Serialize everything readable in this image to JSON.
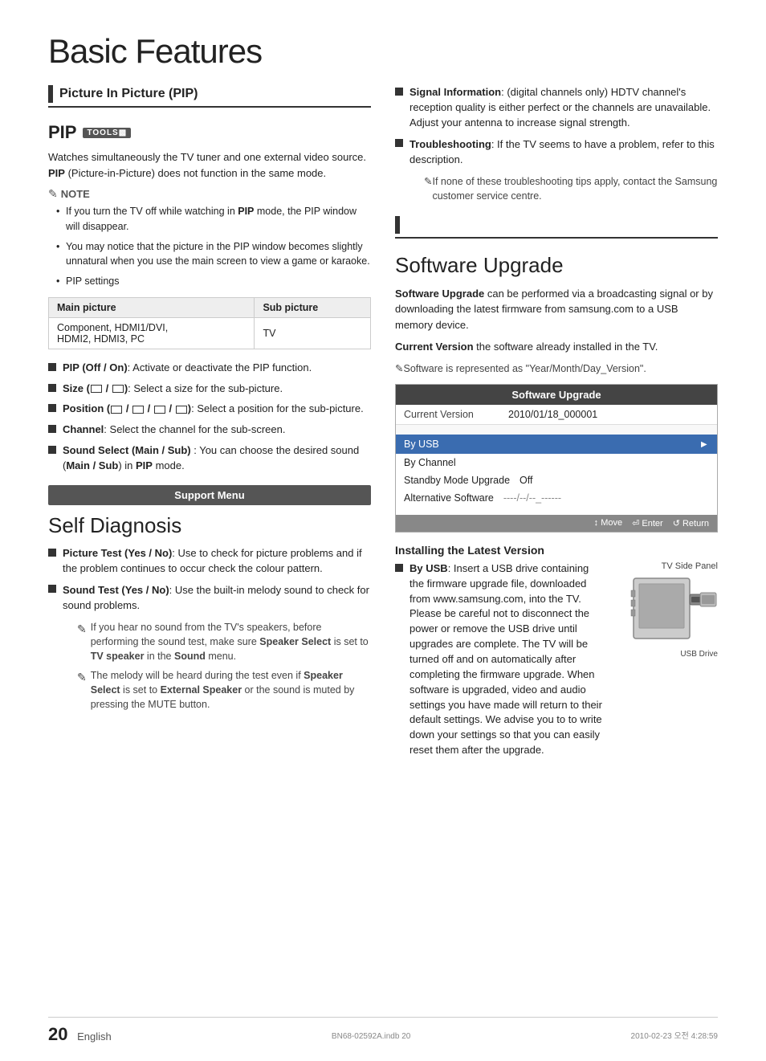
{
  "page": {
    "title": "Basic Features",
    "footer": {
      "page_number": "20",
      "language": "English",
      "file": "BN68-02592A.indb   20",
      "date": "2010-02-23   오전 4:28:59"
    }
  },
  "left_column": {
    "section_title": "Picture In Picture (PIP)",
    "pip": {
      "heading": "PIP",
      "tools_label": "TOOLS",
      "description": "Watches simultaneously the TV tuner and one external video source. PIP (Picture-in-Picture) does not function in the same mode.",
      "note_label": "NOTE",
      "notes": [
        "If you turn the TV off while watching in PIP mode, the PIP window will disappear.",
        "You may notice that the picture in the PIP window becomes slightly unnatural when you use the main screen to view a game or karaoke.",
        "PIP settings"
      ],
      "table": {
        "headers": [
          "Main picture",
          "Sub picture"
        ],
        "rows": [
          [
            "Component, HDMI1/DVI, HDMI2, HDMI3, PC",
            "TV"
          ]
        ]
      },
      "bullet_items": [
        {
          "label": "PIP (Off / On)",
          "text": ": Activate or deactivate the PIP function."
        },
        {
          "label": "Size (□ / □)",
          "text": ": Select a size for the sub-picture."
        },
        {
          "label": "Position (□ / □ / □ / □)",
          "text": ": Select a position for the sub-picture."
        },
        {
          "label": "Channel",
          "text": ": Select the channel for the sub-screen."
        },
        {
          "label": "Sound Select (Main / Sub)",
          "text": " : You can choose the desired sound (Main / Sub) in PIP mode."
        }
      ]
    },
    "support_menu": {
      "label": "Support Menu"
    },
    "self_diagnosis": {
      "heading": "Self Diagnosis",
      "bullet_items": [
        {
          "label": "Picture Test (Yes / No)",
          "text": ": Use to check for picture problems and if the problem continues to occur check the colour pattern."
        },
        {
          "label": "Sound Test (Yes / No)",
          "text": ": Use the built-in melody sound to check for sound problems."
        }
      ],
      "sub_notes": [
        "If you hear no sound from the TV's speakers, before performing the sound test, make sure Speaker Select is set to TV speaker in the Sound menu.",
        "The melody will be heard during the test even if Speaker Select is set to External Speaker or the sound is muted by pressing the MUTE button."
      ]
    }
  },
  "right_column": {
    "signal_info": {
      "label": "Signal Information",
      "text": ": (digital channels only) HDTV channel's reception quality is either perfect or the channels are unavailable. Adjust your antenna to increase signal strength."
    },
    "troubleshooting": {
      "label": "Troubleshooting",
      "text": ": If the TV seems to have a problem, refer to this description."
    },
    "troubleshooting_note": "If none of these troubleshooting tips apply, contact the Samsung customer service centre.",
    "software_upgrade": {
      "heading": "Software Upgrade",
      "description": "Software Upgrade can be performed via a broadcasting signal or by downloading the latest firmware from samsung.com to a USB memory device.",
      "current_version_label": "Current Version",
      "current_version_text": " the software already installed in the TV.",
      "note": "Software is represented as \"Year/Month/Day_Version\".",
      "box": {
        "title": "Software Upgrade",
        "rows": [
          {
            "label": "Current Version",
            "value": "2010/01/18_000001"
          }
        ],
        "menu_items": [
          {
            "label": "By USB",
            "arrow": true,
            "active": true
          },
          {
            "label": "By Channel",
            "arrow": false,
            "active": false
          },
          {
            "label": "Standby Mode Upgrade",
            "value": "Off",
            "active": false
          },
          {
            "label": "Alternative Software",
            "value": "----/--/--_------",
            "active": false
          }
        ],
        "bottom_bar": {
          "move": "Move",
          "enter": "Enter",
          "return": "Return"
        }
      },
      "installing": {
        "heading": "Installing the Latest Version",
        "by_usb_label": "By USB",
        "by_usb_text": ": Insert a USB drive containing the firmware upgrade file, downloaded from www.samsung.com, into the TV. Please be careful not to disconnect the power or remove the USB drive until upgrades are complete. The TV will be turned off and on automatically after completing the firmware upgrade. When software is upgraded, video and audio settings you have made will return to their default settings. We advise you to to write down your settings so that you can easily reset them after the upgrade.",
        "tv_label": "TV Side Panel",
        "usb_label": "USB Drive"
      }
    }
  }
}
